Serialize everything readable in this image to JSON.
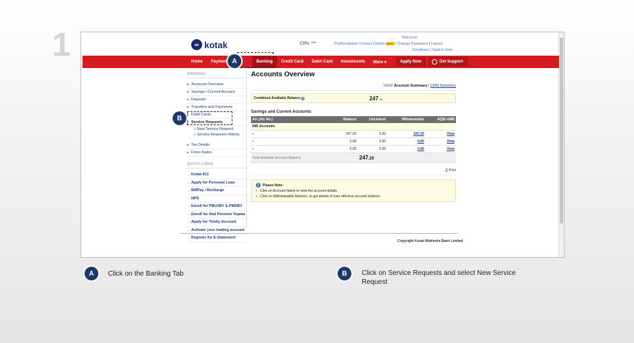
{
  "step_number": "1",
  "header": {
    "logo_text": "kotak",
    "crn": "CRN: ***",
    "welcome": "Welcome",
    "profile_link": "Profile/Update Contact Details",
    "new_badge": "NEW",
    "change_password": "Change Password",
    "logout": "Logout",
    "feedback": "Feedback",
    "switch_view": "Switch View"
  },
  "nav": {
    "items": [
      "Home",
      "Payment/T",
      "Banking",
      "Credit Card",
      "Debit Card",
      "Investments",
      "More"
    ],
    "apply_now": "Apply Now",
    "get_support": "Get Support"
  },
  "sidebar": {
    "heading": "BANKING",
    "items": [
      "Accounts Overview",
      "Savings / Current Account",
      "Deposits",
      "Transfers and Payments",
      "Debit Cards"
    ],
    "service_requests": "Service Requests",
    "sub_items": [
      "New Service Request",
      "Service Requests History"
    ],
    "items2": [
      "Tax Details",
      "Forex Rates"
    ],
    "quick_heading": "QUICK LINKS",
    "quick_links": [
      "Kotak 811",
      "Apply for Personal Loan",
      "BillPay / Recharge",
      "NPS",
      "Enroll for PMJJBY & PMSBY",
      "Enroll for Atal Pension Yojana",
      "Apply for Trinity Account",
      "Activate your trading account",
      "Register for E-Statement"
    ]
  },
  "main": {
    "title": "Accounts Overview",
    "view_label": "VIEW",
    "account_summary": "Account Summary",
    "crn_summary": "CRN Summary",
    "combined_label": "Combined Available Balance",
    "combined_value": "247",
    "combined_decimals": ".20",
    "section_title": "Savings and Current Accounts",
    "columns": [
      "A/c (A/c No.)",
      "Balance",
      "Uncleared",
      "Withdrawable",
      "AQB/ AMB"
    ],
    "inr_label": "INR Accounts",
    "rows": [
      {
        "balance": "247.20",
        "uncleared": "0.00",
        "withdrawable": "247.20",
        "action": "View"
      },
      {
        "balance": "0.00",
        "uncleared": "0.00",
        "withdrawable": "0.00",
        "action": "View"
      },
      {
        "balance": "0.00",
        "uncleared": "0.00",
        "withdrawable": "0.00",
        "action": "View"
      }
    ],
    "total_label": "Total Available Account Balance",
    "total_value": "247",
    "total_decimals": ".20",
    "print_label": "Print",
    "note_title": "Please Note:",
    "notes": [
      "Click on Account Name to view the account details.",
      "Click on Withdrawable Balance, to get details of your effective account balance."
    ]
  },
  "footer": {
    "copyright": "Copyright Kotak Mahindra Bank Limited"
  },
  "callouts": {
    "a_letter": "A",
    "b_letter": "B",
    "a_text": "Click on the Banking Tab",
    "b_text": "Click on Service Requests and select New Service Request"
  },
  "colors": {
    "brand_red": "#d71920",
    "brand_navy": "#1a2a6c",
    "callout": "#1b3a6b"
  }
}
